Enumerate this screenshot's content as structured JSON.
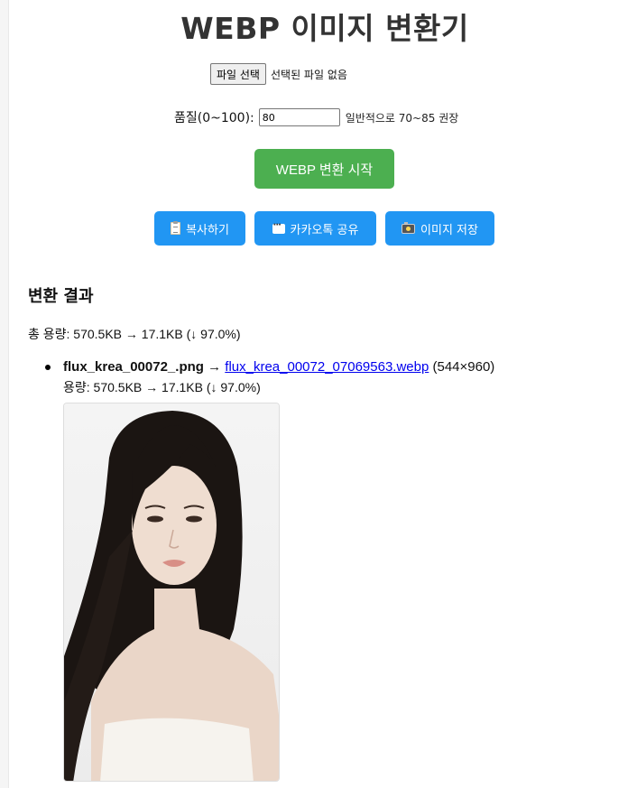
{
  "page": {
    "title": "WEBP 이미지 변환기"
  },
  "file_picker": {
    "button_label": "파일 선택",
    "status_text": "선택된 파일 없음"
  },
  "quality": {
    "label": "품질(0~100):",
    "value": "80",
    "hint": "일반적으로 70~85 권장"
  },
  "convert_button": {
    "label": "WEBP 변환 시작",
    "color": "#4caf50"
  },
  "actions": [
    {
      "label": "복사하기",
      "icon": "clipboard-icon"
    },
    {
      "label": "카카오톡 공유",
      "icon": "speech-bubble-icon"
    },
    {
      "label": "이미지 저장",
      "icon": "camera-icon"
    }
  ],
  "action_color": "#2196f3",
  "results": {
    "heading": "변환 결과",
    "total_summary": "총 용량: 570.5KB → 17.1KB (↓ 97.0%)",
    "items": [
      {
        "source_name": "flux_krea_00072_.png",
        "arrow": "→",
        "output_name": "flux_krea_00072_07069563.webp",
        "dimensions": "(544×960)",
        "size_summary": "용량: 570.5KB → 17.1KB (↓ 97.0%)",
        "preview_icon": "portrait-photo"
      }
    ]
  }
}
